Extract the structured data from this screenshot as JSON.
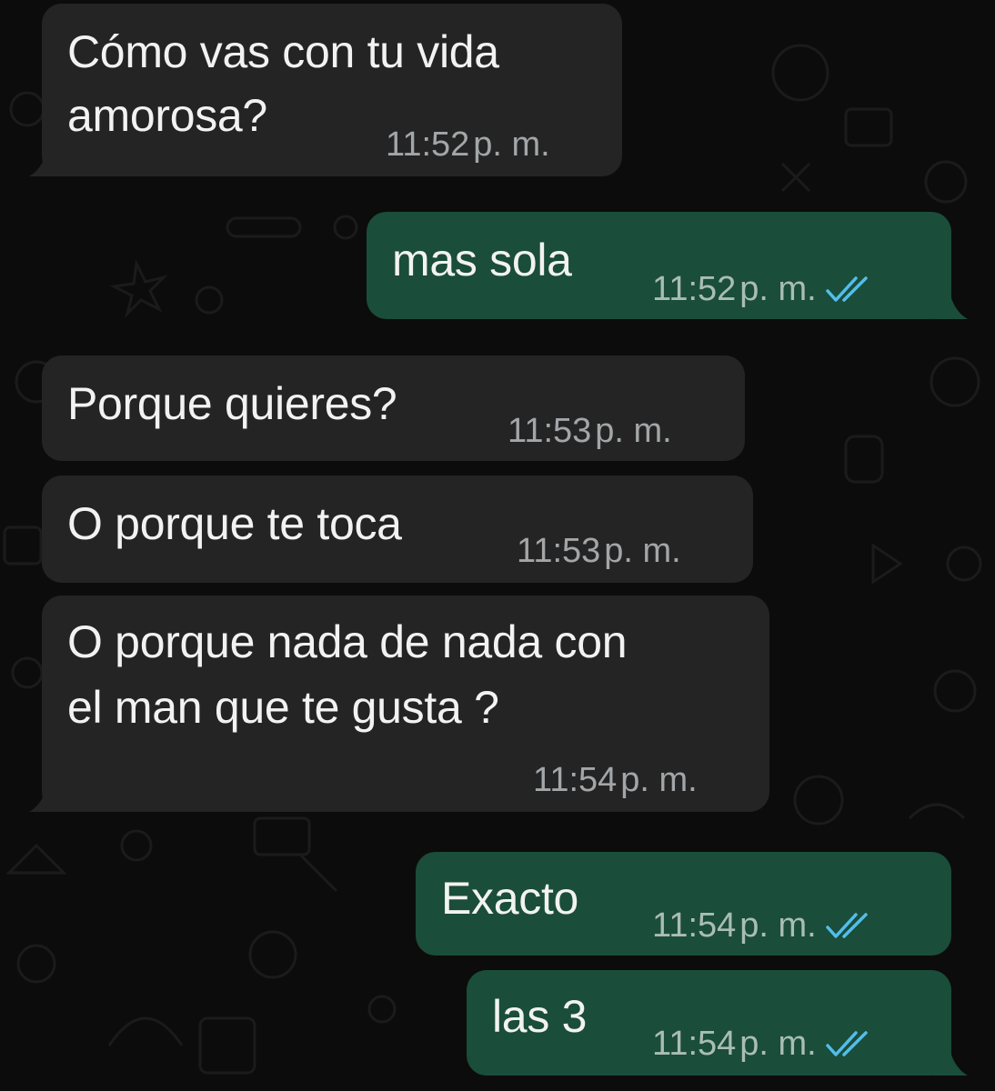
{
  "conversation": {
    "messages": [
      {
        "direction": "incoming",
        "lines": [
          "Cómo vas con tu vida",
          "amorosa?"
        ],
        "time": "11:52",
        "period": "p. m."
      },
      {
        "direction": "outgoing",
        "lines": [
          "mas sola"
        ],
        "time": "11:52",
        "period": "p. m.",
        "status": "read"
      },
      {
        "direction": "incoming",
        "lines": [
          "Porque quieres?"
        ],
        "time": "11:53",
        "period": "p. m."
      },
      {
        "direction": "incoming",
        "lines": [
          "O porque te toca"
        ],
        "time": "11:53",
        "period": "p. m."
      },
      {
        "direction": "incoming",
        "lines": [
          "O porque nada de nada con",
          "el man que te gusta ?"
        ],
        "time": "11:54",
        "period": "p. m."
      },
      {
        "direction": "outgoing",
        "lines": [
          "Exacto"
        ],
        "time": "11:54",
        "period": "p. m.",
        "status": "read"
      },
      {
        "direction": "outgoing",
        "lines": [
          "las 3"
        ],
        "time": "11:54",
        "period": "p. m.",
        "status": "read"
      }
    ]
  },
  "colors": {
    "background": "#0c0c0c",
    "incoming_bubble": "#242424",
    "outgoing_bubble": "#1a4d3a",
    "read_ticks": "#53bdeb"
  },
  "icons": {
    "read_status": "double-check-icon"
  }
}
